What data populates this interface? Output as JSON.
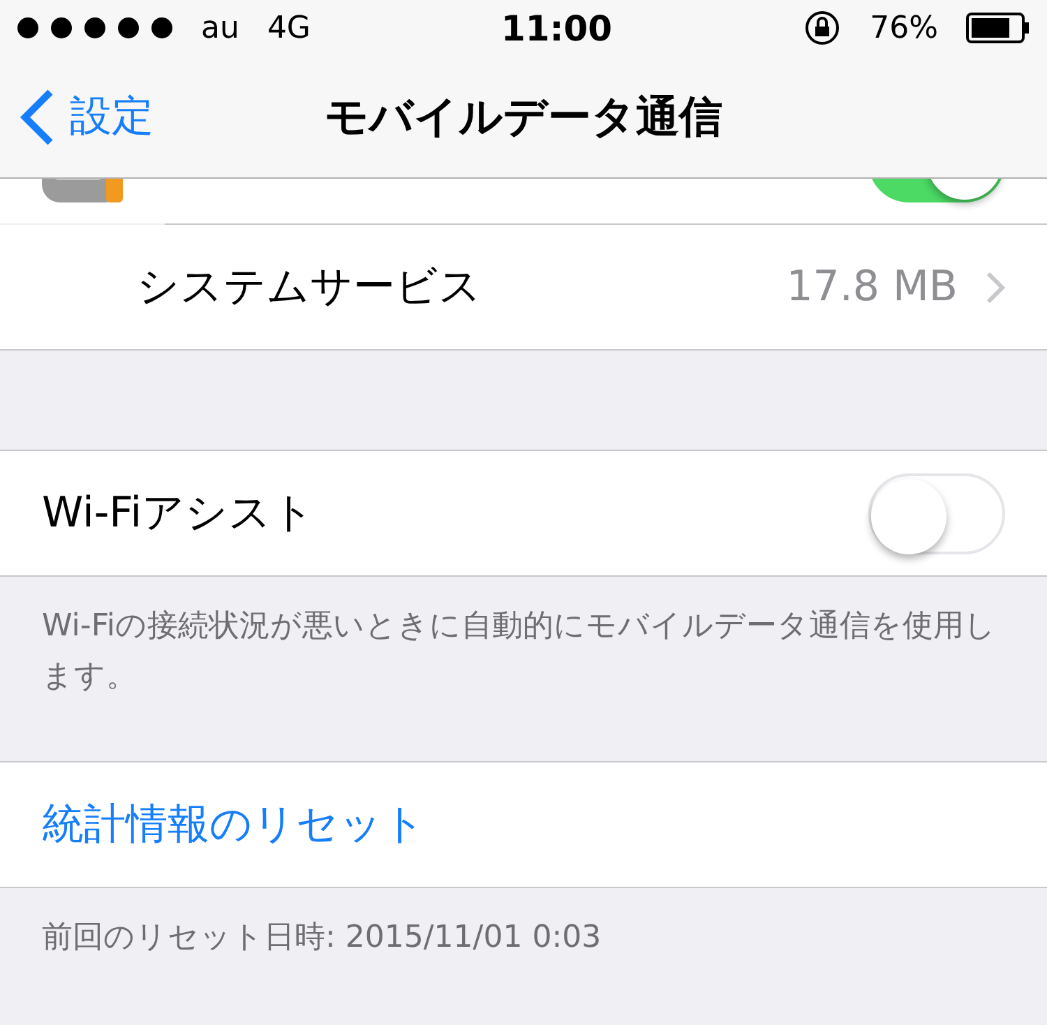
{
  "status_bar": {
    "carrier": "au",
    "network": "4G",
    "time": "11:00",
    "battery": "76%"
  },
  "nav": {
    "back": "設定",
    "title": "モバイルデータ通信"
  },
  "partial_row": {
    "on": true
  },
  "system_services": {
    "label": "システムサービス",
    "value": "17.8 MB"
  },
  "wifi_assist": {
    "label": "Wi-Fiアシスト",
    "on": false,
    "note": "Wi-Fiの接続状況が悪いときに自動的にモバイルデータ通信を使用します。"
  },
  "reset": {
    "label": "統計情報のリセット",
    "note": "前回のリセット日時: 2015/11/01 0:03"
  }
}
